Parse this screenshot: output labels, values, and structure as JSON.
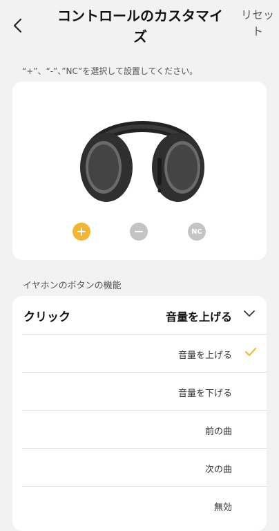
{
  "header": {
    "title": "コントロールのカスタマイズ",
    "reset_label": "リセット"
  },
  "instruction": "“+”、“-”、”NC”を選択して設置してください。",
  "controls": [
    {
      "name": "plus",
      "symbol": "+",
      "selected": true
    },
    {
      "name": "minus",
      "symbol": "−",
      "selected": false
    },
    {
      "name": "nc",
      "symbol": "NC",
      "selected": false
    }
  ],
  "section_label": "イヤホンのボタンの機能",
  "function": {
    "label": "クリック",
    "value": "音量を上げる",
    "options": [
      {
        "label": "音量を上げる",
        "selected": true
      },
      {
        "label": "音量を下げる",
        "selected": false
      },
      {
        "label": "前の曲",
        "selected": false
      },
      {
        "label": "次の曲",
        "selected": false
      },
      {
        "label": "無効",
        "selected": false
      }
    ]
  },
  "colors": {
    "accent": "#f4b632",
    "inactive": "#c4c4c4",
    "background": "#f2f2f2"
  }
}
